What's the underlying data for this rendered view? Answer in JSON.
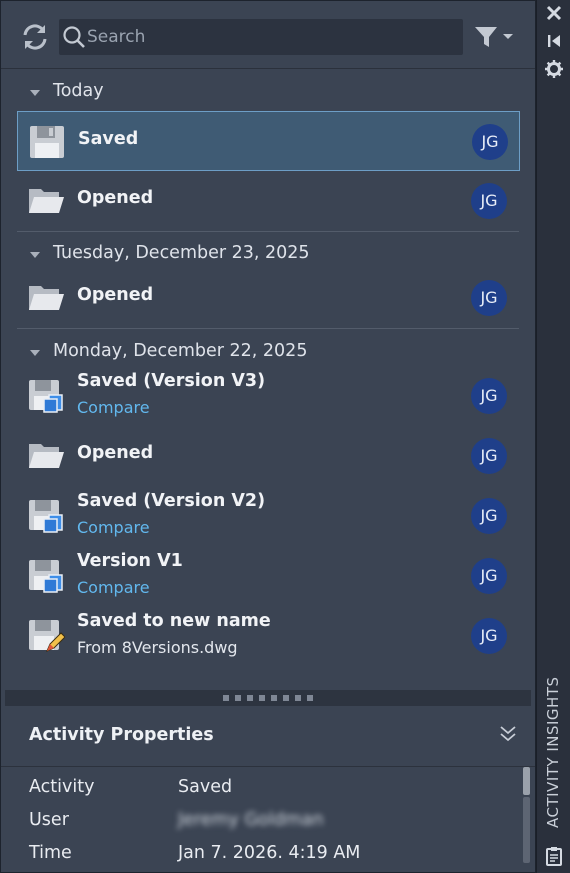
{
  "toolbar": {
    "search_placeholder": "Search",
    "refresh_icon": "refresh-icon",
    "filter_icon": "filter-icon"
  },
  "groups": [
    {
      "label": "Today",
      "items": [
        {
          "title": "Saved",
          "sub": "",
          "icon": "floppy-disk-icon",
          "user": "JG",
          "selected": true
        },
        {
          "title": "Opened",
          "sub": "",
          "icon": "folder-open-icon",
          "user": "JG",
          "selected": false
        }
      ]
    },
    {
      "label": "Tuesday, December 23, 2025",
      "items": [
        {
          "title": "Opened",
          "sub": "",
          "icon": "folder-open-icon",
          "user": "JG",
          "selected": false
        }
      ]
    },
    {
      "label": "Monday, December 22, 2025",
      "items": [
        {
          "title": "Saved (Version V3)",
          "sub": "Compare",
          "icon": "save-version-icon",
          "user": "JG",
          "selected": false
        },
        {
          "title": "Opened",
          "sub": "",
          "icon": "folder-open-icon",
          "user": "JG",
          "selected": false
        },
        {
          "title": "Saved (Version V2)",
          "sub": "Compare",
          "icon": "save-version-icon",
          "user": "JG",
          "selected": false
        },
        {
          "title": "Version V1",
          "sub": "Compare",
          "icon": "save-version-icon",
          "user": "JG",
          "selected": false
        },
        {
          "title": "Saved to new name",
          "sub": "From 8Versions.dwg",
          "icon": "save-as-icon",
          "user": "JG",
          "selected": false
        }
      ]
    }
  ],
  "properties": {
    "title": "Activity Properties",
    "rows": [
      {
        "key": "Activity",
        "value": "Saved"
      },
      {
        "key": "User",
        "value": "Jeremy Goldman"
      },
      {
        "key": "Time",
        "value": "Jan 7. 2026. 4:19 AM"
      }
    ]
  },
  "side_strip": {
    "label": "ACTIVITY INSIGHTS",
    "buttons": [
      "close-icon",
      "pin-icon",
      "settings-icon",
      "clipboard-icon"
    ]
  },
  "colors": {
    "panel_bg": "#3b4453",
    "selected_bg": "#3f5b74",
    "selected_border": "#6d9ec6",
    "link": "#62b8ee",
    "avatar_bg": "#1f3f8a"
  }
}
